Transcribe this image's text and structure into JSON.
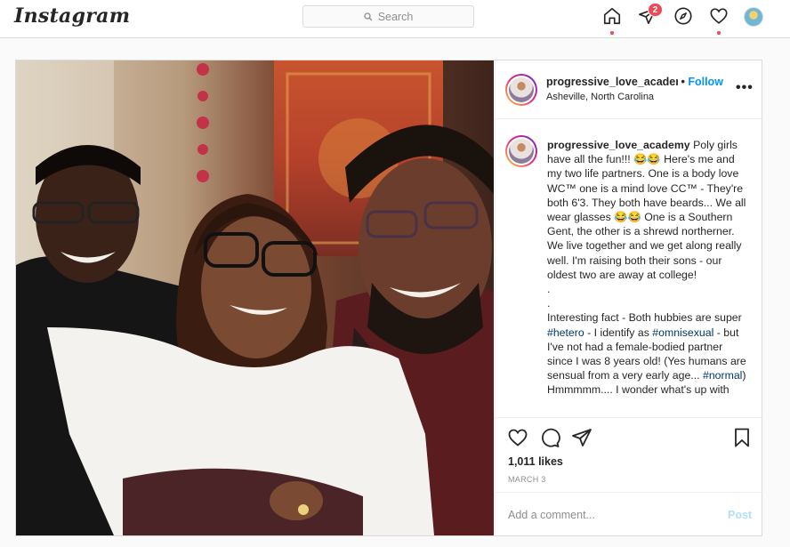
{
  "topbar": {
    "logo": "Instagram",
    "search_placeholder": "Search",
    "notification_count": "2"
  },
  "post": {
    "author": {
      "username": "progressive_love_academy",
      "follow_label": "Follow",
      "location": "Asheville, North Carolina"
    },
    "caption": {
      "username": "progressive_love_academy",
      "part1": "Poly girls have all the fun!!! 😂😂 Here's me and my two life partners. One is a body love WC™ one is a mind love CC™ - They're both 6'3. They both have beards... We all wear glasses 😂😂 One is a Southern Gent, the other is a shrewd northerner. We live together and we get along really well. I'm raising both their sons - our oldest two are away at college!",
      "dot1": ".",
      "dot2": ".",
      "part2": "Interesting fact - Both hubbies are super",
      "tag1": "#hetero",
      "part3": "- I identify as",
      "tag2": "#omnisexual",
      "part4": "- but I've not had a female-bodied partner since I was 8 years old! (Yes humans are sensual from a very early age...",
      "tag3": "#normal",
      "part5": ") Hmmmmm.... I wonder what's up with"
    },
    "likes": "1,011 likes",
    "date": "MARCH 3",
    "comment_placeholder": "Add a comment...",
    "post_label": "Post"
  },
  "icons": [
    "home-icon",
    "direct-icon",
    "explore-icon",
    "heart-icon",
    "profile-avatar",
    "more-icon",
    "like-icon",
    "comment-icon",
    "share-icon",
    "save-icon",
    "search-icon"
  ],
  "colors": {
    "accent": "#0095f6",
    "badge": "#ed4956",
    "hashtag": "#00376b"
  }
}
